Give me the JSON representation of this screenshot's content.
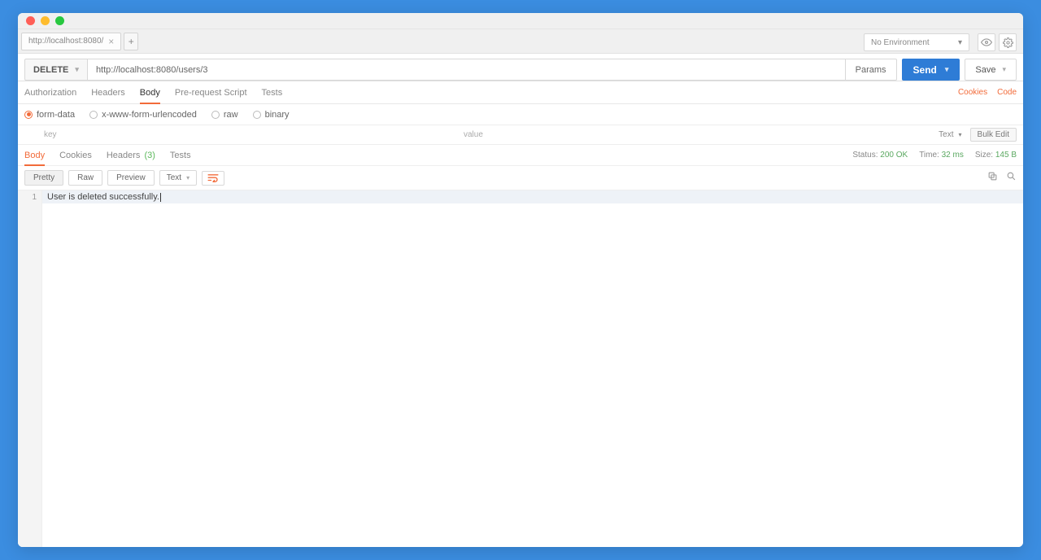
{
  "tab": {
    "title": "http://localhost:8080/"
  },
  "env": {
    "selected": "No Environment"
  },
  "request": {
    "method": "DELETE",
    "url": "http://localhost:8080/users/3",
    "params_label": "Params",
    "send_label": "Send",
    "save_label": "Save"
  },
  "request_tabs": {
    "authorization": "Authorization",
    "headers": "Headers",
    "body": "Body",
    "prerequest": "Pre-request Script",
    "tests": "Tests",
    "cookies_link": "Cookies",
    "code_link": "Code"
  },
  "body_types": {
    "form_data": "form-data",
    "xwww": "x-www-form-urlencoded",
    "raw": "raw",
    "binary": "binary"
  },
  "kv": {
    "key_placeholder": "key",
    "value_placeholder": "value",
    "type_label": "Text",
    "bulk_edit": "Bulk Edit"
  },
  "response_tabs": {
    "body": "Body",
    "cookies": "Cookies",
    "headers": "Headers",
    "headers_count": "(3)",
    "tests": "Tests"
  },
  "status": {
    "status_label": "Status:",
    "status_value": "200 OK",
    "time_label": "Time:",
    "time_value": "32 ms",
    "size_label": "Size:",
    "size_value": "145 B"
  },
  "view": {
    "pretty": "Pretty",
    "raw": "Raw",
    "preview": "Preview",
    "format": "Text"
  },
  "response_body": {
    "line1_number": "1",
    "line1_text": "User is deleted successfully."
  }
}
